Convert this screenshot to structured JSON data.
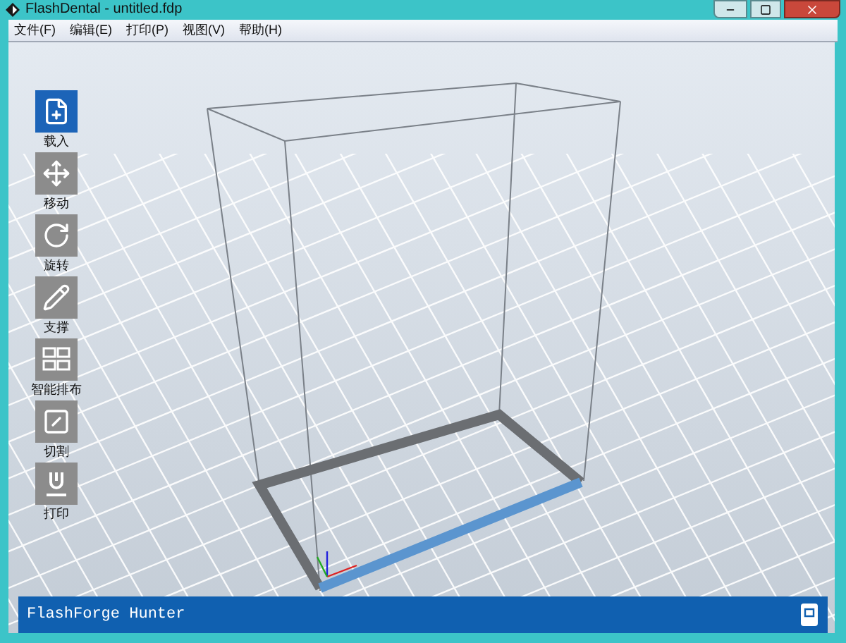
{
  "window": {
    "title": "FlashDental - untitled.fdp"
  },
  "menu": [
    "文件(F)",
    "编辑(E)",
    "打印(P)",
    "视图(V)",
    "帮助(H)"
  ],
  "tools": [
    {
      "label": "载入",
      "kind": "load",
      "selected": true
    },
    {
      "label": "移动",
      "kind": "move",
      "selected": false
    },
    {
      "label": "旋转",
      "kind": "rotate",
      "selected": false
    },
    {
      "label": "支撑",
      "kind": "support",
      "selected": false
    },
    {
      "label": "智能排布",
      "kind": "arrange",
      "selected": false
    },
    {
      "label": "切割",
      "kind": "cut",
      "selected": false
    },
    {
      "label": "打印",
      "kind": "print",
      "selected": false
    }
  ],
  "status_bar": {
    "printer": "FlashForge Hunter"
  }
}
